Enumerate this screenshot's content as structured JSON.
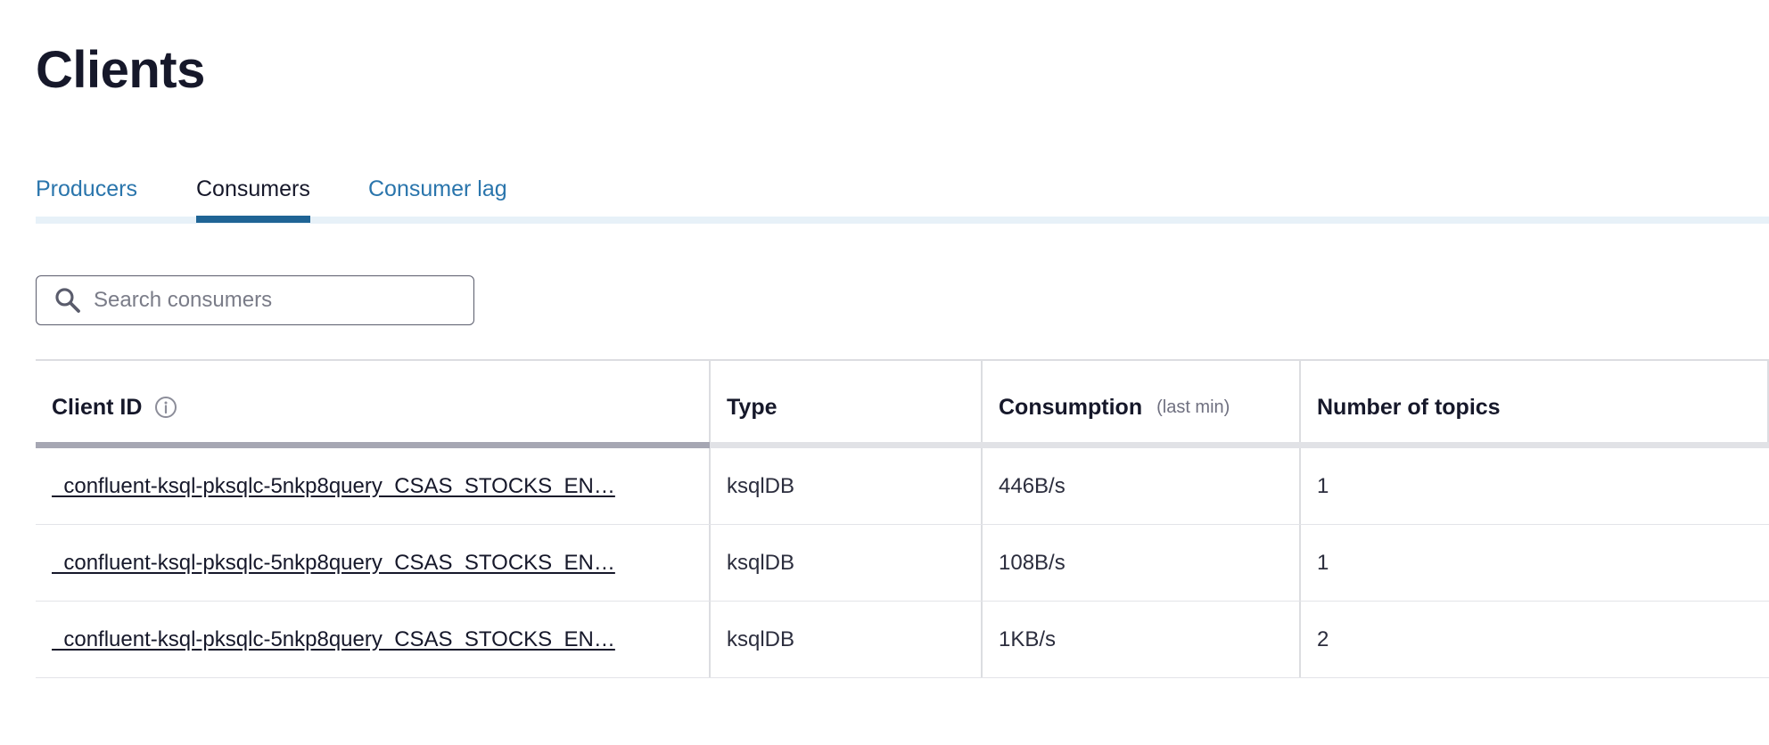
{
  "page": {
    "title": "Clients"
  },
  "tabs": [
    {
      "label": "Producers",
      "active": false
    },
    {
      "label": "Consumers",
      "active": true
    },
    {
      "label": "Consumer lag",
      "active": false
    }
  ],
  "search": {
    "placeholder": "Search consumers",
    "value": "",
    "icon": "search-icon"
  },
  "table": {
    "columns": {
      "client_id": "Client ID",
      "client_id_icon": "info-icon",
      "type": "Type",
      "consumption": "Consumption",
      "consumption_sub": "(last min)",
      "topics": "Number of topics"
    },
    "rows": [
      {
        "client_id": "_confluent-ksql-pksqlc-5nkp8query_CSAS_STOCKS_EN…",
        "type": "ksqlDB",
        "consumption": "446B/s",
        "topics": "1"
      },
      {
        "client_id": "_confluent-ksql-pksqlc-5nkp8query_CSAS_STOCKS_EN…",
        "type": "ksqlDB",
        "consumption": "108B/s",
        "topics": "1"
      },
      {
        "client_id": "_confluent-ksql-pksqlc-5nkp8query_CSAS_STOCKS_EN…",
        "type": "ksqlDB",
        "consumption": "1KB/s",
        "topics": "2"
      }
    ]
  },
  "colors": {
    "tab_link": "#2a75ac",
    "tab_active_bar": "#1f6495",
    "title": "#16182a"
  }
}
